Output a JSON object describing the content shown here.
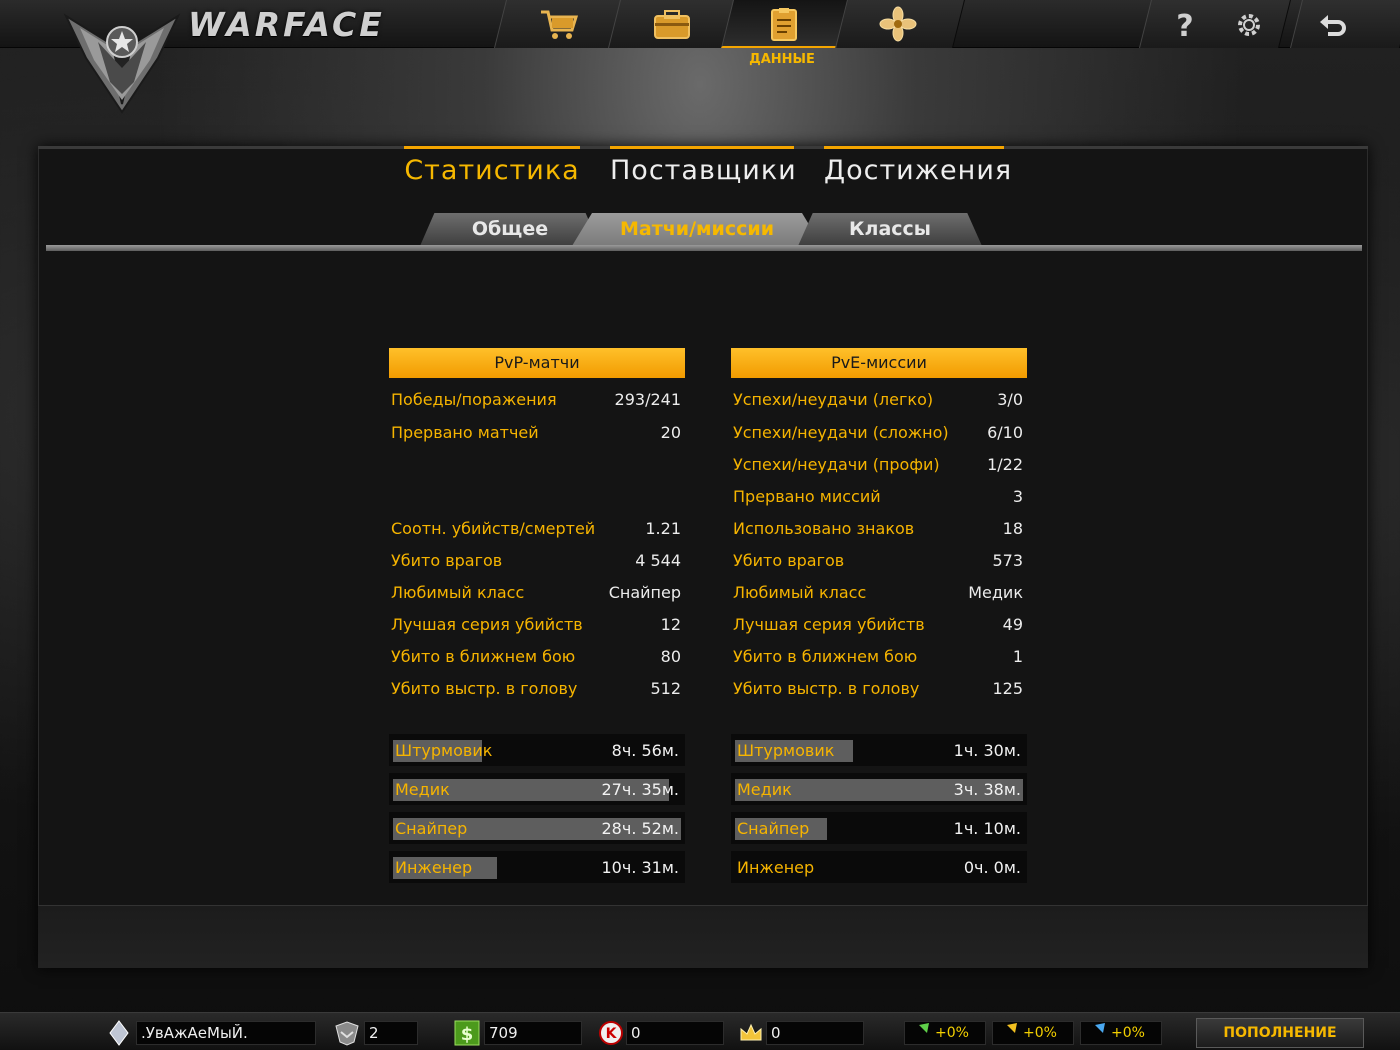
{
  "app": {
    "logo_text": "WARFACE"
  },
  "topnav": {
    "items": [
      {
        "icon": "shopping-cart-icon"
      },
      {
        "icon": "inventory-box-icon"
      },
      {
        "icon": "clipboard-data-icon",
        "label": "ДАННЫЕ",
        "active": true
      },
      {
        "icon": "achievement-flower-icon"
      }
    ],
    "utilities": [
      "help-icon",
      "settings-gear-icon",
      "exit-back-icon"
    ]
  },
  "main_tabs": [
    {
      "label": "Статистика",
      "active": true
    },
    {
      "label": "Поставщики"
    },
    {
      "label": "Достижения"
    }
  ],
  "sub_tabs": [
    {
      "label": "Общее"
    },
    {
      "label": "Матчи/миссии",
      "active": true
    },
    {
      "label": "Классы"
    }
  ],
  "pvp": {
    "title": "PvP-матчи",
    "stats": [
      {
        "label": "Победы/поражения",
        "value": "293/241"
      },
      {
        "label": "Прервано матчей",
        "value": "20"
      },
      {
        "label": "Соотн. убийств/смертей",
        "value": "1.21"
      },
      {
        "label": "Убито врагов",
        "value": "4 544"
      },
      {
        "label": "Любимый класс",
        "value": "Снайпер"
      },
      {
        "label": "Лучшая серия убийств",
        "value": "12"
      },
      {
        "label": "Убито в ближнем бою",
        "value": "80"
      },
      {
        "label": "Убито выстр. в голову",
        "value": "512"
      }
    ],
    "classes": [
      {
        "name": "Штурмовик",
        "time": "8ч. 56м.",
        "fill": 0.31
      },
      {
        "name": "Медик",
        "time": "27ч. 35м.",
        "fill": 0.96
      },
      {
        "name": "Снайпер",
        "time": "28ч. 52м.",
        "fill": 1.0
      },
      {
        "name": "Инженер",
        "time": "10ч. 31м.",
        "fill": 0.36
      }
    ]
  },
  "pve": {
    "title": "PvE-миссии",
    "stats": [
      {
        "label": "Успехи/неудачи (легко)",
        "value": "3/0"
      },
      {
        "label": "Успехи/неудачи (сложно)",
        "value": "6/10"
      },
      {
        "label": "Успехи/неудачи (профи)",
        "value": "1/22"
      },
      {
        "label": "Прервано миссий",
        "value": "3"
      },
      {
        "label": "Использовано знаков",
        "value": "18"
      },
      {
        "label": "Убито врагов",
        "value": "573"
      },
      {
        "label": "Любимый класс",
        "value": "Медик"
      },
      {
        "label": "Лучшая серия убийств",
        "value": "49"
      },
      {
        "label": "Убито в ближнем бою",
        "value": "1"
      },
      {
        "label": "Убито выстр. в голову",
        "value": "125"
      }
    ],
    "classes": [
      {
        "name": "Штурмовик",
        "time": "1ч. 30м.",
        "fill": 0.41
      },
      {
        "name": "Медик",
        "time": "3ч. 38м.",
        "fill": 1.0
      },
      {
        "name": "Снайпер",
        "time": "1ч. 10м.",
        "fill": 0.32
      },
      {
        "name": "Инженер",
        "time": "0ч. 0м.",
        "fill": 0.0
      }
    ]
  },
  "bottombar": {
    "nickname": ".УвАжАеМыЙ.",
    "rank": "2",
    "warbucks": "709",
    "kredits": "0",
    "crowns": "0",
    "bonuses": [
      "+0%",
      "+0%",
      "+0%"
    ],
    "topup_label": "ПОПОЛНЕНИЕ СЧЕТА"
  },
  "colors": {
    "accent": "#f6b400",
    "header_bar": "#f4a500",
    "background": "#141414"
  }
}
